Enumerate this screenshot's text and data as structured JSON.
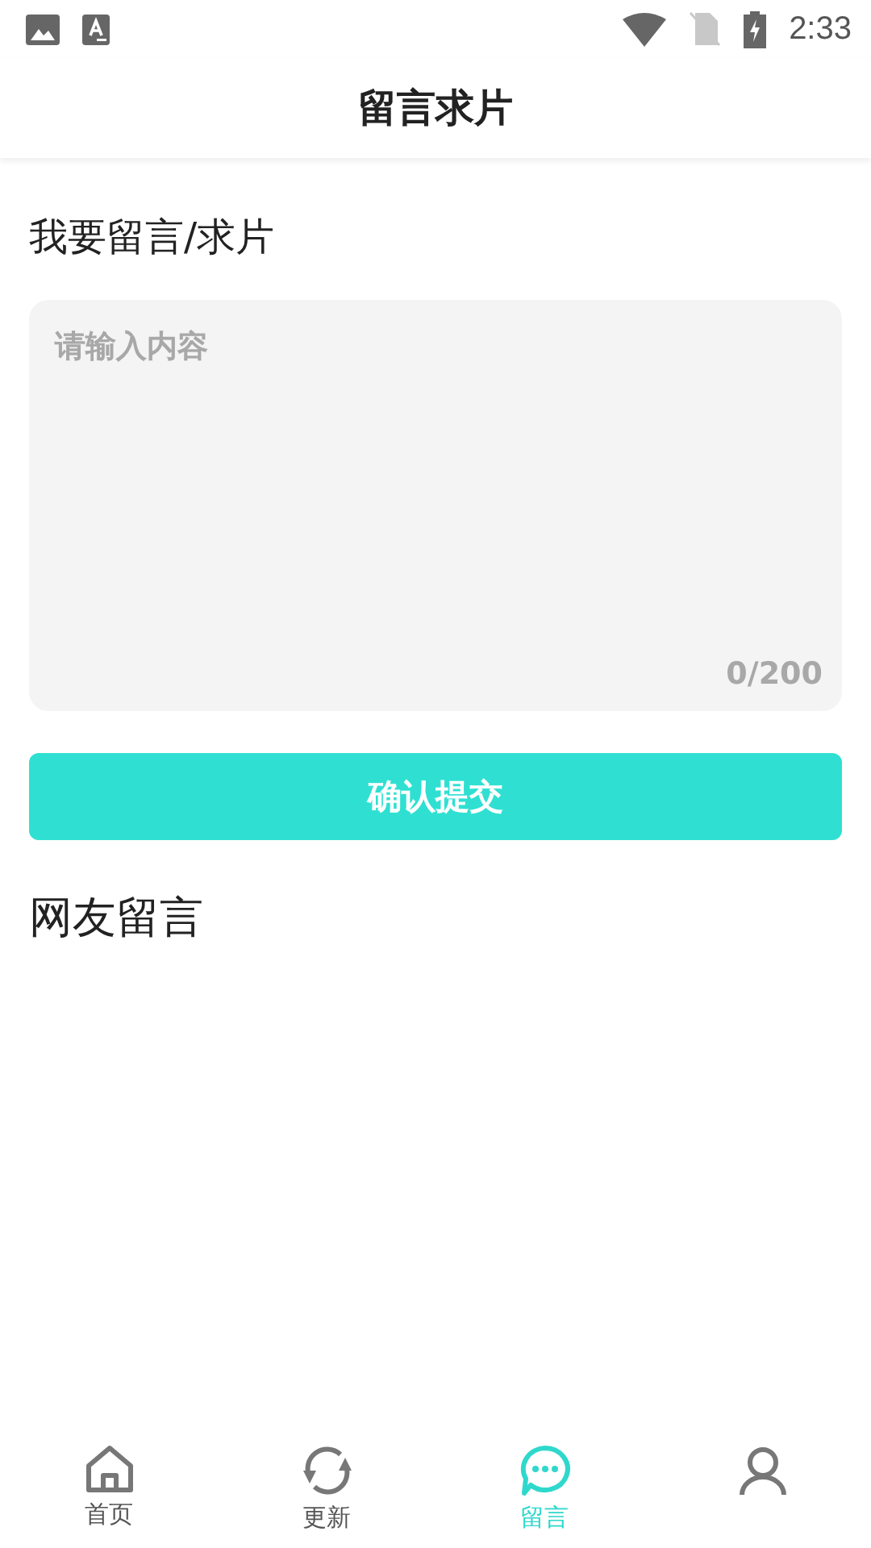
{
  "status_bar": {
    "time": "2:33"
  },
  "header": {
    "title": "留言求片"
  },
  "form": {
    "title": "我要留言/求片",
    "placeholder": "请输入内容",
    "counter": "0/200",
    "submit": "确认提交"
  },
  "comments": {
    "title": "网友留言"
  },
  "nav": [
    {
      "kind": "home",
      "label": "首页",
      "selected": false
    },
    {
      "kind": "refresh",
      "label": "更新",
      "selected": false
    },
    {
      "kind": "chat",
      "label": "留言",
      "selected": true
    },
    {
      "kind": "person",
      "selected": false
    }
  ]
}
